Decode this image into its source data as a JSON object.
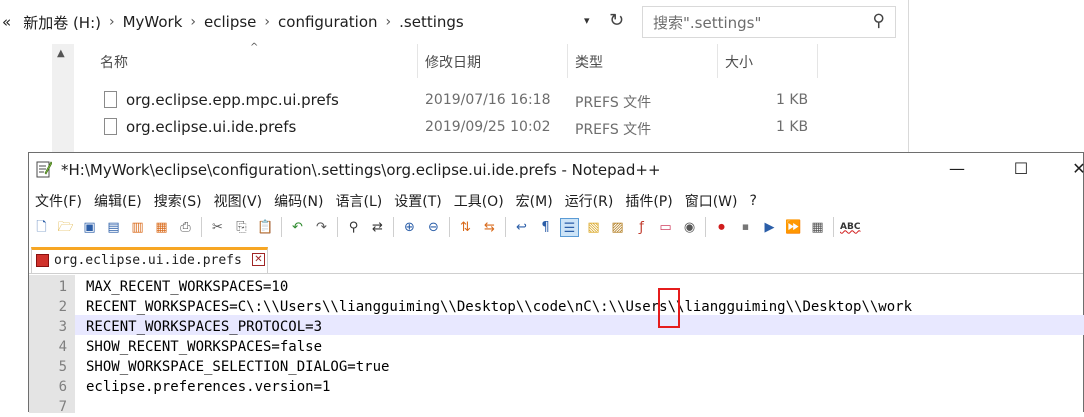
{
  "explorer": {
    "address_back_chevron": "«",
    "breadcrumb": [
      "新加卷 (H:)",
      "MyWork",
      "eclipse",
      "configuration",
      ".settings"
    ],
    "search_placeholder": "搜索\".settings\"",
    "columns": {
      "name": "名称",
      "date": "修改日期",
      "type": "类型",
      "size": "大小"
    },
    "files": [
      {
        "name": "org.eclipse.epp.mpc.ui.prefs",
        "date": "2019/07/16 16:18",
        "type": "PREFS 文件",
        "size": "1 KB"
      },
      {
        "name": "org.eclipse.ui.ide.prefs",
        "date": "2019/09/25 10:02",
        "type": "PREFS 文件",
        "size": "1 KB"
      }
    ]
  },
  "notepad": {
    "title": "*H:\\MyWork\\eclipse\\configuration\\.settings\\org.eclipse.ui.ide.prefs - Notepad++",
    "menu": [
      "文件(F)",
      "编辑(E)",
      "搜索(S)",
      "视图(V)",
      "编码(N)",
      "语言(L)",
      "设置(T)",
      "工具(O)",
      "宏(M)",
      "运行(R)",
      "插件(P)",
      "窗口(W)",
      "?"
    ],
    "tab_label": "org.eclipse.ui.ide.prefs",
    "lines": [
      {
        "num": "1",
        "text": "MAX_RECENT_WORKSPACES=10"
      },
      {
        "num": "2",
        "text": "RECENT_WORKSPACES=C\\:\\\\Users\\\\liangguiming\\\\Desktop\\\\code\\nC\\:\\\\Users\\\\liangguiming\\\\Desktop\\\\work"
      },
      {
        "num": "3",
        "text": "RECENT_WORKSPACES_PROTOCOL=3"
      },
      {
        "num": "4",
        "text": "SHOW_RECENT_WORKSPACES=false"
      },
      {
        "num": "5",
        "text": "SHOW_WORKSPACE_SELECTION_DIALOG=true"
      },
      {
        "num": "6",
        "text": "eclipse.preferences.version=1"
      },
      {
        "num": "7",
        "text": ""
      }
    ],
    "toolbar_icons": [
      "new-file-icon",
      "open-file-icon",
      "save-icon",
      "save-all-icon",
      "close-icon",
      "close-all-icon",
      "print-icon",
      "cut-icon",
      "copy-icon",
      "paste-icon",
      "undo-icon",
      "redo-icon",
      "find-icon",
      "replace-icon",
      "zoom-in-icon",
      "zoom-out-icon",
      "sync-vertical-icon",
      "sync-horizontal-icon",
      "word-wrap-icon",
      "show-all-chars-icon",
      "indent-guide-icon",
      "document-map-icon",
      "user-lang-icon",
      "function-list-icon",
      "folder-workspace-icon",
      "monitor-icon",
      "record-macro-icon",
      "stop-record-icon",
      "play-macro-icon",
      "run-macro-icon",
      "save-macro-icon",
      "spellcheck-icon"
    ],
    "accent_color": "#f7a623",
    "highlight_color": "#e51c1c"
  }
}
